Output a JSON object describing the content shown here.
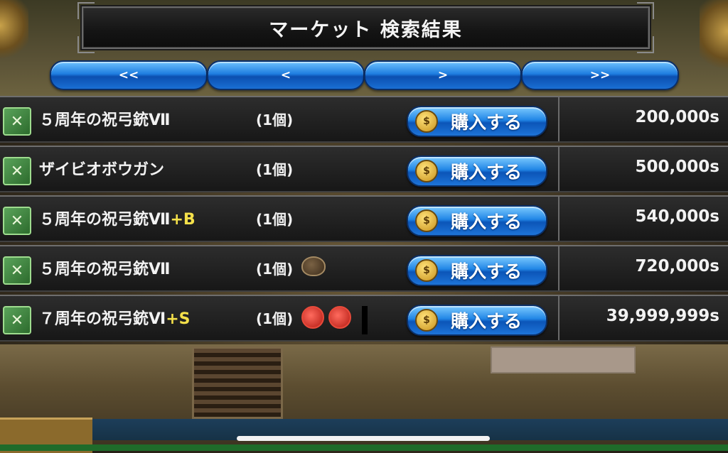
{
  "title": "マーケット 検索結果",
  "pagination": {
    "first": "<<",
    "prev": "<",
    "next": ">",
    "last": ">>"
  },
  "buy_label": "購入する",
  "rows": [
    {
      "name": "５周年の祝弓銃Ⅶ",
      "suffix": "",
      "qty": "(1個)",
      "gems": [],
      "price": "200,000s"
    },
    {
      "name": "ザイビオボウガン",
      "suffix": "",
      "qty": "(1個)",
      "gems": [],
      "price": "500,000s"
    },
    {
      "name": "５周年の祝弓銃Ⅶ",
      "suffix": "+B",
      "qty": "(1個)",
      "gems": [],
      "price": "540,000s"
    },
    {
      "name": "５周年の祝弓銃Ⅶ",
      "suffix": "",
      "qty": "(1個)",
      "gems": [
        "dark"
      ],
      "price": "720,000s"
    },
    {
      "name": "７周年の祝弓銃Ⅵ",
      "suffix": "+S",
      "qty": "(1個)",
      "gems": [
        "red",
        "red"
      ],
      "price": "39,999,999s"
    }
  ],
  "icons": {
    "item": "crossbow-icon",
    "coin": "coin-icon"
  },
  "colors": {
    "buy_button": "#1e7de0",
    "suffix": "#f4e04a",
    "item_icon": "#5aa35a"
  }
}
